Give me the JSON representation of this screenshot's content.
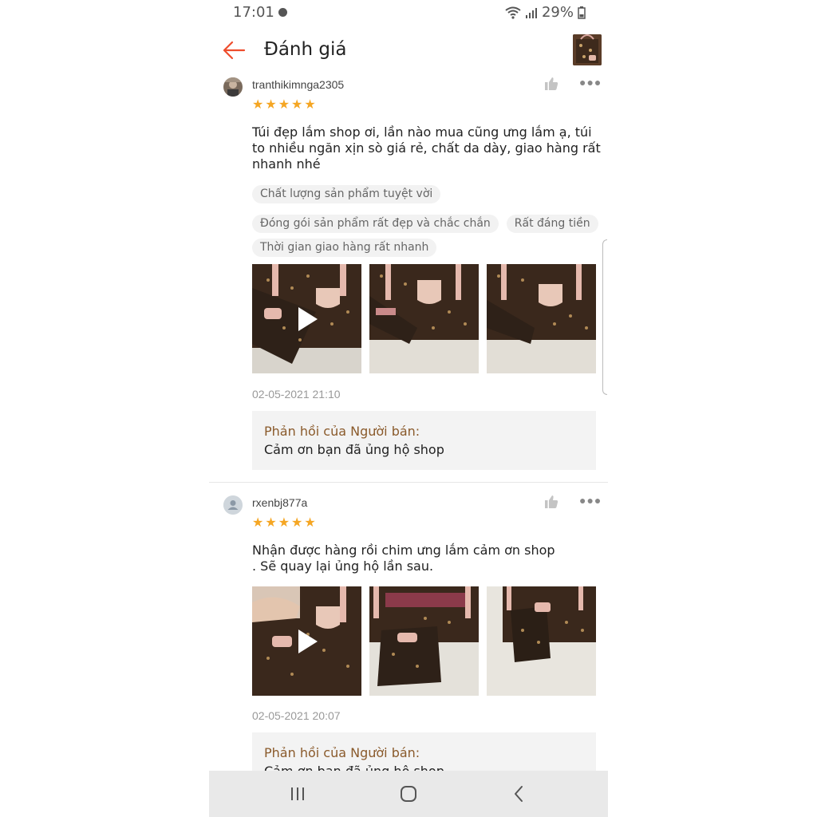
{
  "status_bar": {
    "time": "17:01",
    "battery": "29%"
  },
  "header": {
    "title": "Đánh giá"
  },
  "reviews": [
    {
      "username": "tranthikimnga2305",
      "stars": 5,
      "text": "Túi đẹp lắm shop ơi, lần nào mua cũng ưng lắm ạ, túi to nhiều ngăn xịn sò giá rẻ, chất da dày, giao hàng rất nhanh nhé",
      "tags": [
        "Chất lượng sản phẩm tuyệt vời",
        "Đóng gói sản phẩm rất đẹp và chắc chắn",
        "Rất đáng tiền",
        "Thời gian giao hàng rất nhanh"
      ],
      "date": "02-05-2021 21:10",
      "reply_title": "Phản hồi của Người bán:",
      "reply_text": "Cảm ơn bạn đã ủng hộ shop"
    },
    {
      "username": "rxenbj877a",
      "stars": 5,
      "text_line1": "Nhận được hàng rồi chim ưng lắm cảm ơn shop",
      "text_line2": ". Sẽ quay lại ủng hộ lần sau.",
      "date": "02-05-2021 20:07",
      "reply_title": "Phản hồi của Người bán:",
      "reply_text": "Cảm ơn bạn đã ủng hộ shop"
    }
  ],
  "icons": {
    "back": "arrow-left-icon",
    "like": "thumbs-up-icon",
    "more": "more-dots-icon",
    "play": "play-icon",
    "nav_recent": "recent-apps-icon",
    "nav_home": "home-icon",
    "nav_back": "chevron-left-icon"
  },
  "colors": {
    "accent": "#ee4d2d",
    "star": "#f5a623",
    "reply_title": "#8a5a2b"
  }
}
